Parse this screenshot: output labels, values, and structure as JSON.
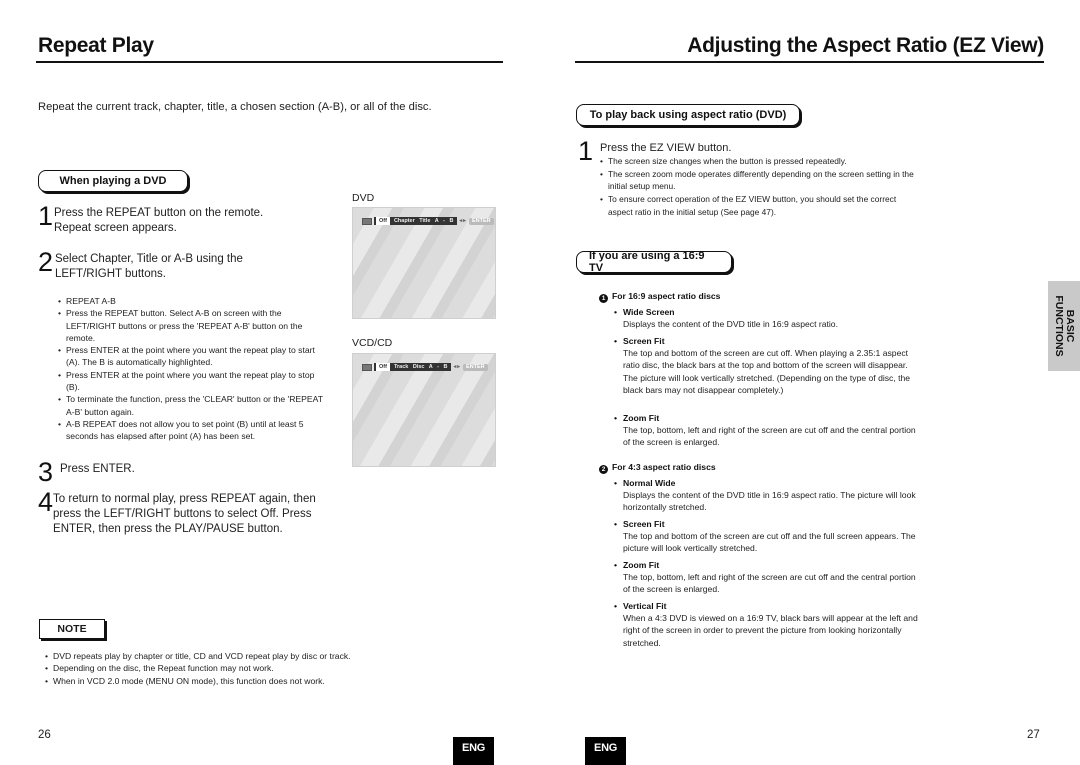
{
  "left_page": {
    "title": "Repeat Play",
    "intro": "Repeat the current track, chapter, title, a chosen section (A-B), or all of the disc.",
    "section_label": "When playing a DVD",
    "steps": [
      {
        "num": "1",
        "text": "Press the REPEAT button on the remote. Repeat screen appears."
      },
      {
        "num": "2",
        "text": "Select Chapter, Title or A-B using the LEFT/RIGHT buttons."
      },
      {
        "num": "3",
        "text": "Press ENTER."
      },
      {
        "num": "4",
        "text": "To return to normal play, press REPEAT again, then press the LEFT/RIGHT buttons to select Off. Press ENTER, then press the PLAY/PAUSE button."
      }
    ],
    "bullets": [
      "REPEAT A-B",
      "Press the REPEAT button. Select A-B on screen with the LEFT/RIGHT buttons or press the 'REPEAT A-B' button on the remote.",
      "Press ENTER at the point where you want the repeat play to start (A). The B is automatically highlighted.",
      "Press ENTER at the point where you want the repeat play to stop (B).",
      "To terminate the function, press the 'CLEAR' button or the 'REPEAT A-B' button again.",
      "A-B REPEAT does not allow you to set point (B) until at least 5 seconds has elapsed after point (A) has been set."
    ],
    "screens": [
      {
        "label": "DVD",
        "off": "Off",
        "options": "Chapter  Title  A - B",
        "nav": "◂▸",
        "enter": "ENTER"
      },
      {
        "label": "VCD/CD",
        "off": "Off",
        "options": "Track  Disc  A - B",
        "nav": "◂▸",
        "enter": "ENTER"
      }
    ],
    "note_label": "NOTE",
    "notes": [
      "DVD repeats play by chapter or title, CD and VCD repeat play by disc or track.",
      "Depending on the disc, the Repeat function may not work.",
      "When in VCD 2.0 mode (MENU ON mode), this function does not work."
    ],
    "page_number": "26",
    "lang_badge": "ENG"
  },
  "right_page": {
    "title": "Adjusting the Aspect Ratio (EZ View)",
    "section1_label": "To play back using aspect ratio (DVD)",
    "step1": {
      "num": "1",
      "text": "Press the EZ VIEW button."
    },
    "step1_bullets": [
      "The screen size changes when the button is pressed repeatedly.",
      "The screen zoom mode operates differently depending on the screen setting in the initial setup menu.",
      "To ensure correct operation of the EZ VIEW button, you should set the correct aspect ratio in the initial setup (See page 47)."
    ],
    "section2_label": "If you are using a 16:9 TV",
    "group1": {
      "num": "1",
      "title": "For 16:9 aspect ratio discs",
      "items": [
        {
          "head": "Wide Screen",
          "text": "Displays the content of the DVD title in 16:9 aspect ratio."
        },
        {
          "head": "Screen Fit",
          "text": "The top and bottom of the screen are cut off. When playing a 2.35:1 aspect ratio disc, the black bars at the top and bottom of the screen will disappear. The picture will look vertically stretched. (Depending on the type of disc, the black bars may not disappear completely.)"
        },
        {
          "head": "Zoom Fit",
          "text": "The top, bottom, left and right of the screen are cut off and the central portion of the screen is enlarged."
        }
      ]
    },
    "group2": {
      "num": "2",
      "title": "For 4:3 aspect ratio discs",
      "items": [
        {
          "head": "Normal Wide",
          "text": "Displays the content of the DVD title in 16:9 aspect ratio. The picture will look horizontally stretched."
        },
        {
          "head": "Screen Fit",
          "text": "The top and bottom of the screen are cut off and the full screen appears. The picture will look vertically stretched."
        },
        {
          "head": "Zoom Fit",
          "text": "The top, bottom, left and right of the screen are cut off and the central portion of the screen is enlarged."
        },
        {
          "head": "Vertical Fit",
          "text": "When a 4:3 DVD is viewed on a 16:9 TV, black bars will appear at the left and right of the screen in order to prevent the picture from looking horizontally stretched."
        }
      ]
    },
    "side_tab": {
      "line1": "BASIC",
      "line2": "FUNCTIONS"
    },
    "page_number": "27",
    "lang_badge": "ENG"
  }
}
